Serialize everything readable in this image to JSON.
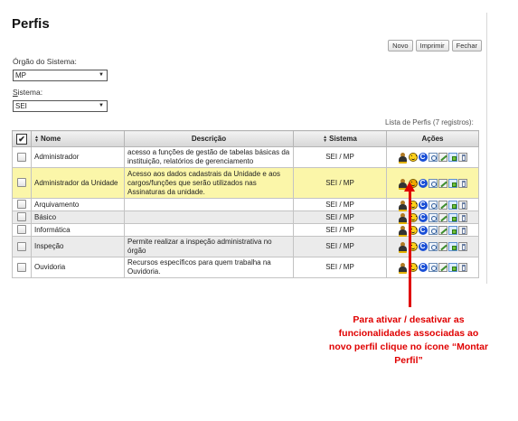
{
  "page": {
    "title": "Perfis"
  },
  "toolbar": {
    "novo": "Novo",
    "imprimir": "Imprimir",
    "fechar": "Fechar"
  },
  "filters": {
    "orgao": {
      "label": "Órgão do Sistema:",
      "value": "MP"
    },
    "sistema": {
      "label_first": "S",
      "label_rest": "istema:",
      "value": "SEI"
    }
  },
  "table": {
    "caption": "Lista de Perfis (7 registros):",
    "columns": {
      "nome": "Nome",
      "descricao": "Descrição",
      "sistema": "Sistema",
      "acoes": "Ações"
    },
    "rows": [
      {
        "nome": "Administrador",
        "descricao": "acesso a funções de gestão de tabelas básicas da instituição, relatórios de gerenciamento",
        "sistema": "SEI / MP"
      },
      {
        "nome": "Administrador da Unidade",
        "descricao": "Acesso aos dados cadastrais da Unidade e aos cargos/funções que serão utilizados nas Assinaturas da unidade.",
        "sistema": "SEI / MP",
        "highlighted": true
      },
      {
        "nome": "Arquivamento",
        "descricao": "",
        "sistema": "SEI / MP"
      },
      {
        "nome": "Básico",
        "descricao": "",
        "sistema": "SEI / MP"
      },
      {
        "nome": "Informática",
        "descricao": "",
        "sistema": "SEI / MP"
      },
      {
        "nome": "Inspeção",
        "descricao": "Permite realizar a inspeção administrativa no órgão",
        "sistema": "SEI / MP"
      },
      {
        "nome": "Ouvidoria",
        "descricao": "Recursos específicos para quem trabalha na Ouvidoria.",
        "sistema": "SEI / MP"
      }
    ],
    "action_icons": [
      "user-permissions-icon",
      "montar-perfil-smiley-icon",
      "copy-c-icon",
      "view-icon",
      "edit-icon",
      "clone-icon",
      "delete-icon"
    ]
  },
  "annotation": {
    "text": "Para ativar / desativar as funcionalidades associadas ao novo perfil clique no ícone “Montar Perfil”",
    "color": "#e00000"
  },
  "colors": {
    "highlight_row": "#fbf6a9",
    "alt_row": "#ebebeb",
    "annotation": "#e00000"
  }
}
